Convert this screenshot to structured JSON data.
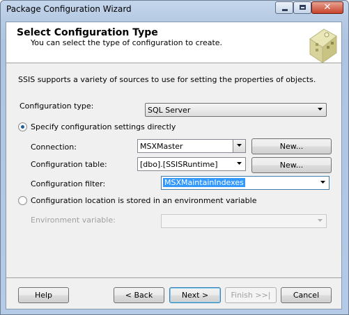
{
  "window": {
    "title": "Package Configuration Wizard"
  },
  "header": {
    "title": "Select Configuration Type",
    "subtitle": "You can select the type of configuration to create."
  },
  "intro": "SSIS supports a variety of sources to use for setting the properties of objects.",
  "config_type": {
    "label": "Configuration type:",
    "value": "SQL Server"
  },
  "option_direct": {
    "label": "Specify configuration settings directly",
    "selected": true
  },
  "connection": {
    "label": "Connection:",
    "value": "MSXMaster",
    "new_button": "New..."
  },
  "config_table": {
    "label": "Configuration table:",
    "value": "[dbo].[SSISRuntime]",
    "new_button": "New..."
  },
  "config_filter": {
    "label": "Configuration filter:",
    "value": "MSXMaintainIndexes"
  },
  "option_env": {
    "label": "Configuration location is stored in an environment variable",
    "selected": false
  },
  "env_var": {
    "label": "Environment variable:",
    "value": ""
  },
  "footer": {
    "help": "Help",
    "back": "< Back",
    "next": "Next >",
    "finish": "Finish >>|",
    "cancel": "Cancel"
  },
  "icons": [
    "minimize-icon",
    "maximize-icon",
    "close-icon",
    "wizard-header-icon",
    "chevron-down-icon"
  ],
  "colors": {
    "selection": "#3399ff",
    "radio_dot": "#1f5c9a",
    "header_bg": "#ffffff",
    "panel_bg": "#f0f0f0"
  }
}
